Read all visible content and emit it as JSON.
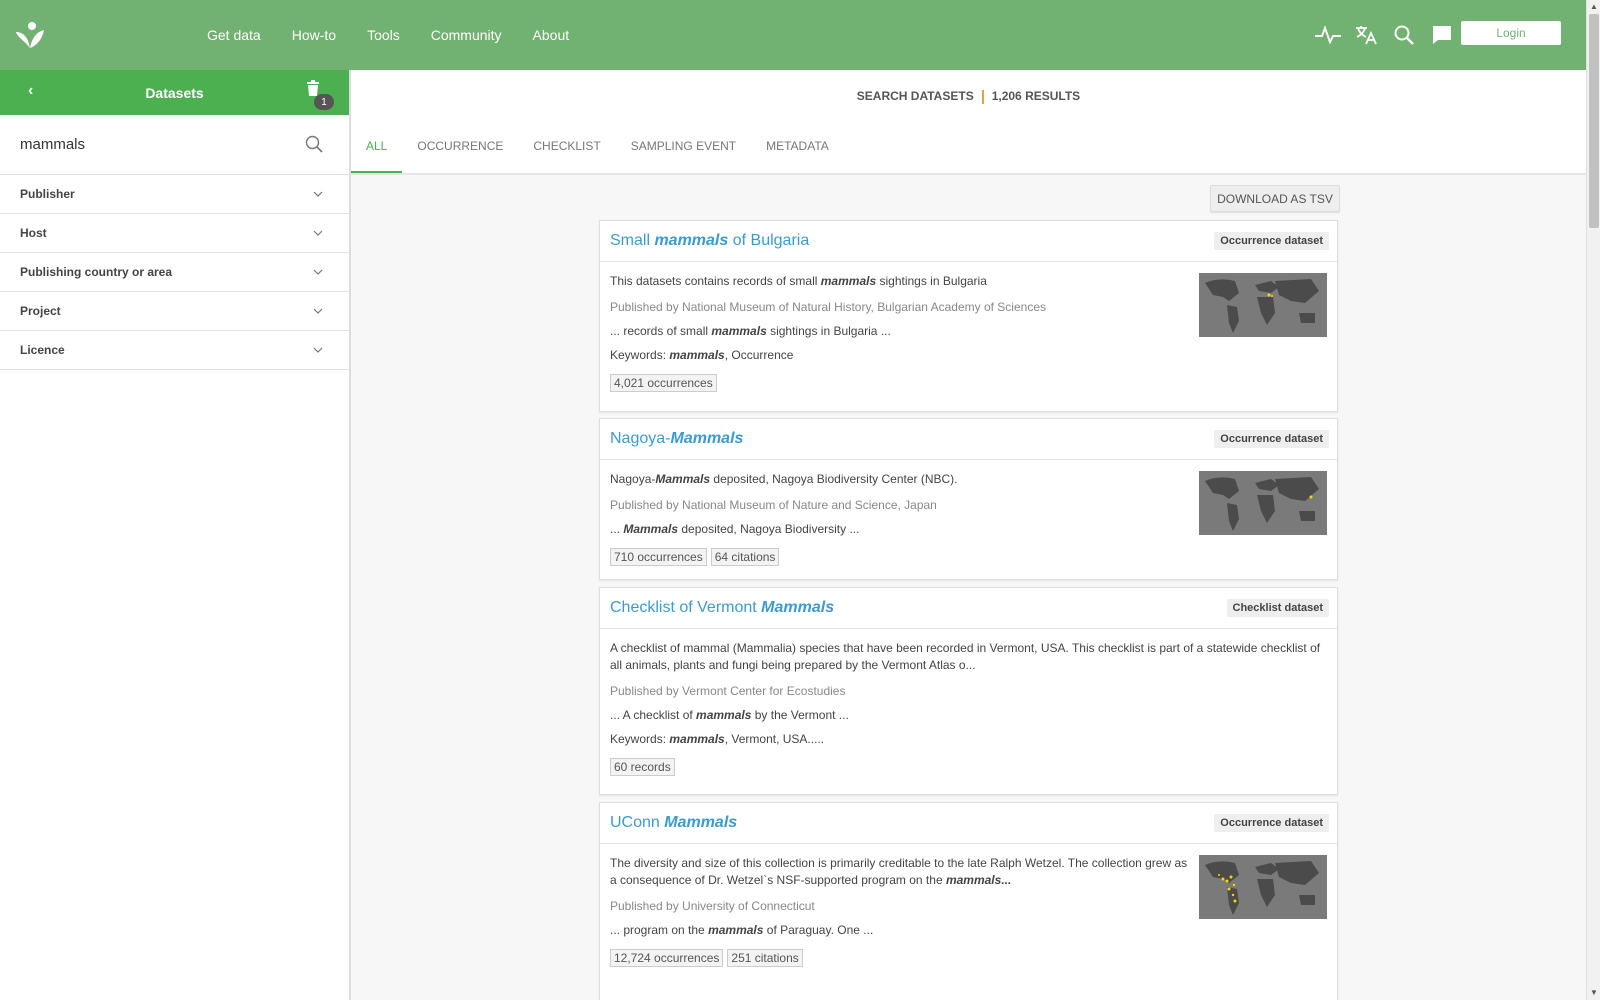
{
  "nav": {
    "items": [
      "Get data",
      "How-to",
      "Tools",
      "Community",
      "About"
    ],
    "login_label": "Login",
    "icons": [
      "activity-icon",
      "translate-icon",
      "search-icon",
      "feedback-icon"
    ]
  },
  "sidebar": {
    "title": "Datasets",
    "badge_count": "1",
    "search_value": "mammals",
    "facets": [
      "Publisher",
      "Host",
      "Publishing country or area",
      "Project",
      "Licence"
    ]
  },
  "results": {
    "label": "SEARCH DATASETS",
    "count": "1,206 RESULTS",
    "tabs": [
      "ALL",
      "OCCURRENCE",
      "CHECKLIST",
      "SAMPLING EVENT",
      "METADATA"
    ],
    "active_tab": "ALL",
    "download_label": "DOWNLOAD AS TSV",
    "cards": [
      {
        "title_pre": "Small ",
        "title_em": "mammals",
        "title_post": " of Bulgaria",
        "type": "Occurrence dataset",
        "desc_pre": "This datasets contains records of small ",
        "desc_em": "mammals",
        "desc_post": " sightings in Bulgaria",
        "publisher": "Published by National Museum of Natural History, Bulgarian Academy of Sciences",
        "hl_pre": "... records of small ",
        "hl_em": "mammals",
        "hl_post": " sightings in Bulgaria ...",
        "kw_label": "Keywords: ",
        "kw_em": "mammals",
        "kw_post": ", Occurrence",
        "tags": [
          "4,021 occurrences"
        ]
      },
      {
        "title_pre": "Nagoya-",
        "title_em": "Mammals",
        "title_post": "",
        "type": "Occurrence dataset",
        "desc_pre": "Nagoya-",
        "desc_em": "Mammals",
        "desc_post": " deposited, Nagoya Biodiversity Center (NBC).",
        "publisher": "Published by National Museum of Nature and Science, Japan",
        "hl_pre": "... ",
        "hl_em": "Mammals",
        "hl_post": " deposited, Nagoya Biodiversity ...",
        "tags": [
          "710 occurrences",
          "64 citations"
        ]
      },
      {
        "title_pre": "Checklist of Vermont ",
        "title_em": "Mammals",
        "title_post": "",
        "type": "Checklist dataset",
        "desc_pre": "A checklist of mammal (Mammalia) species that have been recorded in Vermont, USA. This checklist is part of a statewide checklist of all animals, plants and fungi being prepared by the Vermont Atlas o...",
        "desc_em": "",
        "desc_post": "",
        "publisher": "Published by Vermont Center for Ecostudies",
        "hl_pre": "... A checklist of ",
        "hl_em": "mammals",
        "hl_post": " by the Vermont ...",
        "kw_label": "Keywords: ",
        "kw_em": "mammals",
        "kw_post": ", Vermont, USA.....",
        "tags": [
          "60 records"
        ]
      },
      {
        "title_pre": "UConn ",
        "title_em": "Mammals",
        "title_post": "",
        "type": "Occurrence dataset",
        "desc_pre": "The diversity and size of this collection is primarily creditable to the late Ralph Wetzel. The collection grew as a consequence of Dr. Wetzel`s NSF-supported program on the ",
        "desc_em": "mammals...",
        "desc_post": "",
        "publisher": "Published by University of Connecticut",
        "hl_pre": "... program on the ",
        "hl_em": "mammals",
        "hl_post": " of Paraguay. One ...",
        "tags": [
          "12,724 occurrences",
          "251 citations"
        ]
      }
    ]
  },
  "colors": {
    "topbar": "#71b171",
    "sidebar_head": "#4caf50",
    "link": "#3a9bd4",
    "accent": "#e8a23b"
  }
}
